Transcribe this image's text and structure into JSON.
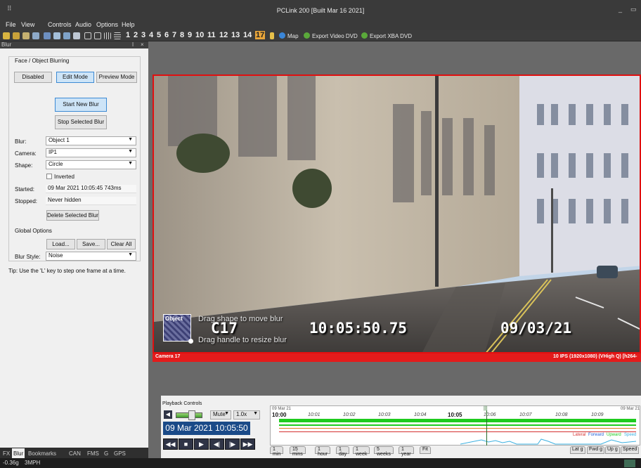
{
  "window": {
    "title": "PCLink 200 [Built Mar 16 2021]",
    "minimize": "_",
    "maximize": "▭"
  },
  "menu": [
    "File",
    "View",
    "Controls",
    "Audio",
    "Options",
    "Help"
  ],
  "toolbar": {
    "camera_numbers": [
      "1",
      "2",
      "3",
      "4",
      "5",
      "6",
      "7",
      "8",
      "9",
      "10",
      "11",
      "12",
      "13",
      "14",
      "17"
    ],
    "active_camera": "17",
    "map_label": "Map",
    "export_video_label": "Export Video DVD",
    "export_xba_label": "Export XBA DVD"
  },
  "blur_panel": {
    "header": "Blur",
    "pin": "ǀ",
    "close": "×",
    "section_title": "Face / Object Blurring",
    "modes": [
      "Disabled",
      "Edit Mode",
      "Preview Mode"
    ],
    "selected_mode": "Edit Mode",
    "start_new": "Start New Blur",
    "stop_selected": "Stop Selected Blur",
    "blur_label": "Blur:",
    "blur_value": "Object 1",
    "camera_label": "Camera:",
    "camera_value": "IP1",
    "shape_label": "Shape:",
    "shape_value": "Circle",
    "inverted_label": "Inverted",
    "started_label": "Started:",
    "started_value": "09 Mar 2021  10:05:45 743ms",
    "stopped_label": "Stopped:",
    "stopped_value": "Never hidden",
    "delete_selected": "Delete Selected Blur",
    "global_options": "Global Options",
    "load": "Load...",
    "save": "Save...",
    "clear_all": "Clear All",
    "blur_style_label": "Blur Style:",
    "blur_style_value": "Noise",
    "tip": "Tip: Use the 'L' key to step one frame at a time."
  },
  "dock_tabs": [
    "FX",
    "Blur",
    "Bookmarks",
    "CAN",
    "FMS",
    "G",
    "GPS"
  ],
  "active_dock_tab": "Blur",
  "status": {
    "g_force": "-0.36g",
    "speed": "3MPH"
  },
  "video": {
    "blur_tag": "Object",
    "drag_move": "Drag shape to move blur",
    "camera_id": "C17",
    "time": "10:05:50.75",
    "date": "09/03/21",
    "drag_resize": "Drag handle to resize blur",
    "footer_left": "Camera 17",
    "footer_right": "10 IPS (1920x1080) (VHigh Q) [h264-"
  },
  "playback": {
    "title": "Playback Controls",
    "mute": "Mute",
    "speed": "1.0x",
    "volume_level": 0.55,
    "date_time": "09 Mar 2021  10:05:50",
    "transport": [
      "◀◀",
      "■",
      "▶",
      "◀|",
      "|▶",
      "▶▶"
    ]
  },
  "timeline": {
    "start_date": "09 Mar 21",
    "end_date": "09 Mar 21",
    "start_time": "10:00",
    "ticks": [
      "10:01",
      "10:02",
      "10:03",
      "10:04",
      "10:05",
      "10:06",
      "10:07",
      "10:08",
      "10:09"
    ],
    "bold_tick": "10:05",
    "cursor_marker": "|||",
    "legend": [
      {
        "name": "Lateral",
        "color": "#d53030"
      },
      {
        "name": "Forward",
        "color": "#1e5bd5"
      },
      {
        "name": "Upward",
        "color": "#1ecb1e"
      },
      {
        "name": "Speed",
        "color": "#3ab0e0"
      }
    ],
    "range_tabs": [
      "1 min",
      "15 mins",
      "1 hour",
      "1 day",
      "1 week",
      "5 weeks",
      "1 year",
      "Fit"
    ],
    "graph_tabs": [
      "Lat g",
      "Fwd g",
      "Up g",
      "Speed"
    ]
  }
}
